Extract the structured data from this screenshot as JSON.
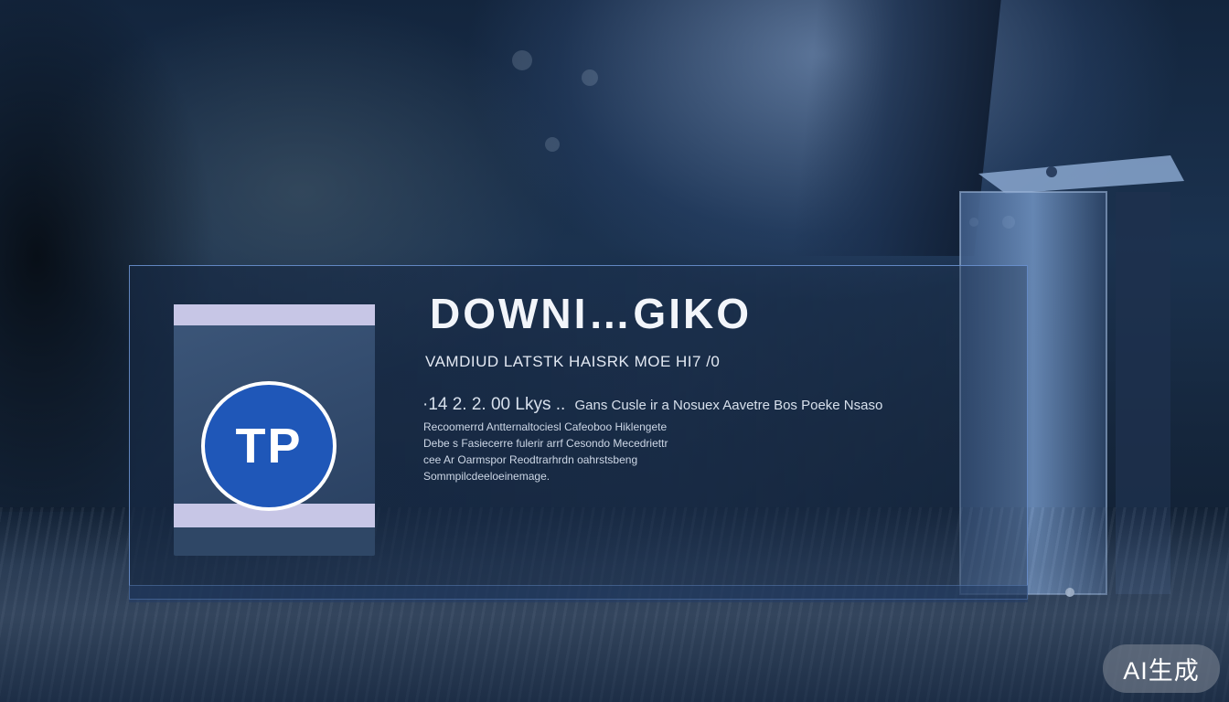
{
  "panel": {
    "icon_label": "TP",
    "title": "DOWNI…GIKO",
    "subtitle": "VAMDIUD LATSTK HAISRK MOE HI7 /0",
    "meta_main": "·14 2. 2. 00  Lkys ..",
    "meta_rest": "Gans Cusle  ir a  Nosuex Aavetre Bos Poeke Nsaso",
    "description_lines": [
      "Recoomerrd Antternaltociesl Cafeoboo Hiklengete",
      "Debe s Fasiecerre fulerir arrf Cesondo Mecedriettr",
      "cee Ar Oarmspor Reodtrarhrdn oahrstsbeng",
      "Sommpilcdeeloeinemage."
    ]
  },
  "watermark": {
    "label": "AI生成"
  },
  "colors": {
    "panel_border": "#6e96d7",
    "badge_blue": "#1f57b8",
    "card_band": "#c7c6e6"
  }
}
